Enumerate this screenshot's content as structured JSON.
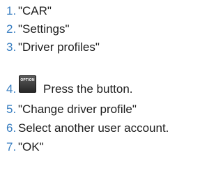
{
  "steps": [
    {
      "num": "1.",
      "text": "\"CAR\""
    },
    {
      "num": "2.",
      "text": "\"Settings\""
    },
    {
      "num": "3.",
      "text": "\"Driver profiles\""
    },
    {
      "num": "4.",
      "icon_label": "OPTION",
      "icon": "option-button-icon",
      "text": "Press the button."
    },
    {
      "num": "5.",
      "text": "\"Change driver profile\""
    },
    {
      "num": "6.",
      "text": "Select another user account."
    },
    {
      "num": "7.",
      "text": "\"OK\""
    }
  ],
  "colors": {
    "number": "#3a7fc1",
    "text": "#1d1d1d",
    "button_bg": "#3a3a3a",
    "button_text": "#ffffff"
  }
}
